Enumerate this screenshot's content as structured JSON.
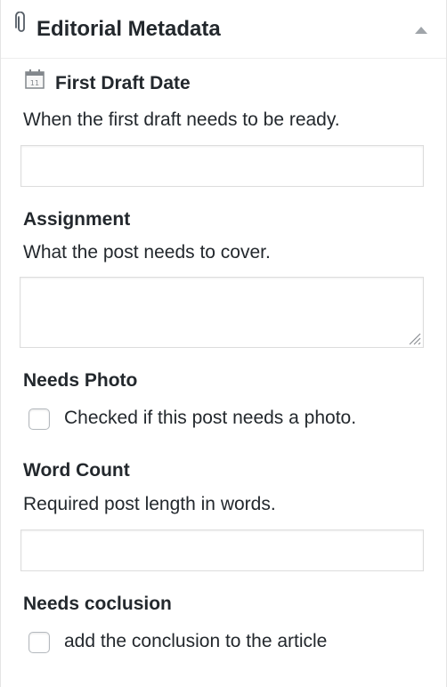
{
  "metabox": {
    "title": "Editorial Metadata",
    "clip_icon": "paperclip-icon",
    "toggle_icon": "collapse-arrow-icon"
  },
  "fields": {
    "first_draft": {
      "label": "First Draft Date",
      "icon": "calendar-icon",
      "calendar_number": "11",
      "description": "When the first draft needs to be ready.",
      "value": ""
    },
    "assignment": {
      "label": "Assignment",
      "description": "What the post needs to cover.",
      "value": ""
    },
    "needs_photo": {
      "label": "Needs Photo",
      "checkbox_label": "Checked if this post needs a photo.",
      "checked": false
    },
    "word_count": {
      "label": "Word Count",
      "description": "Required post length in words.",
      "value": ""
    },
    "needs_conclusion": {
      "label": "Needs coclusion",
      "checkbox_label": "add the conclusion to the article",
      "checked": false
    }
  },
  "colors": {
    "text": "#23282d",
    "border": "#dddddd",
    "checkbox_border": "#b4b9be",
    "icon": "#82878c",
    "toggle": "#a0a5aa"
  }
}
